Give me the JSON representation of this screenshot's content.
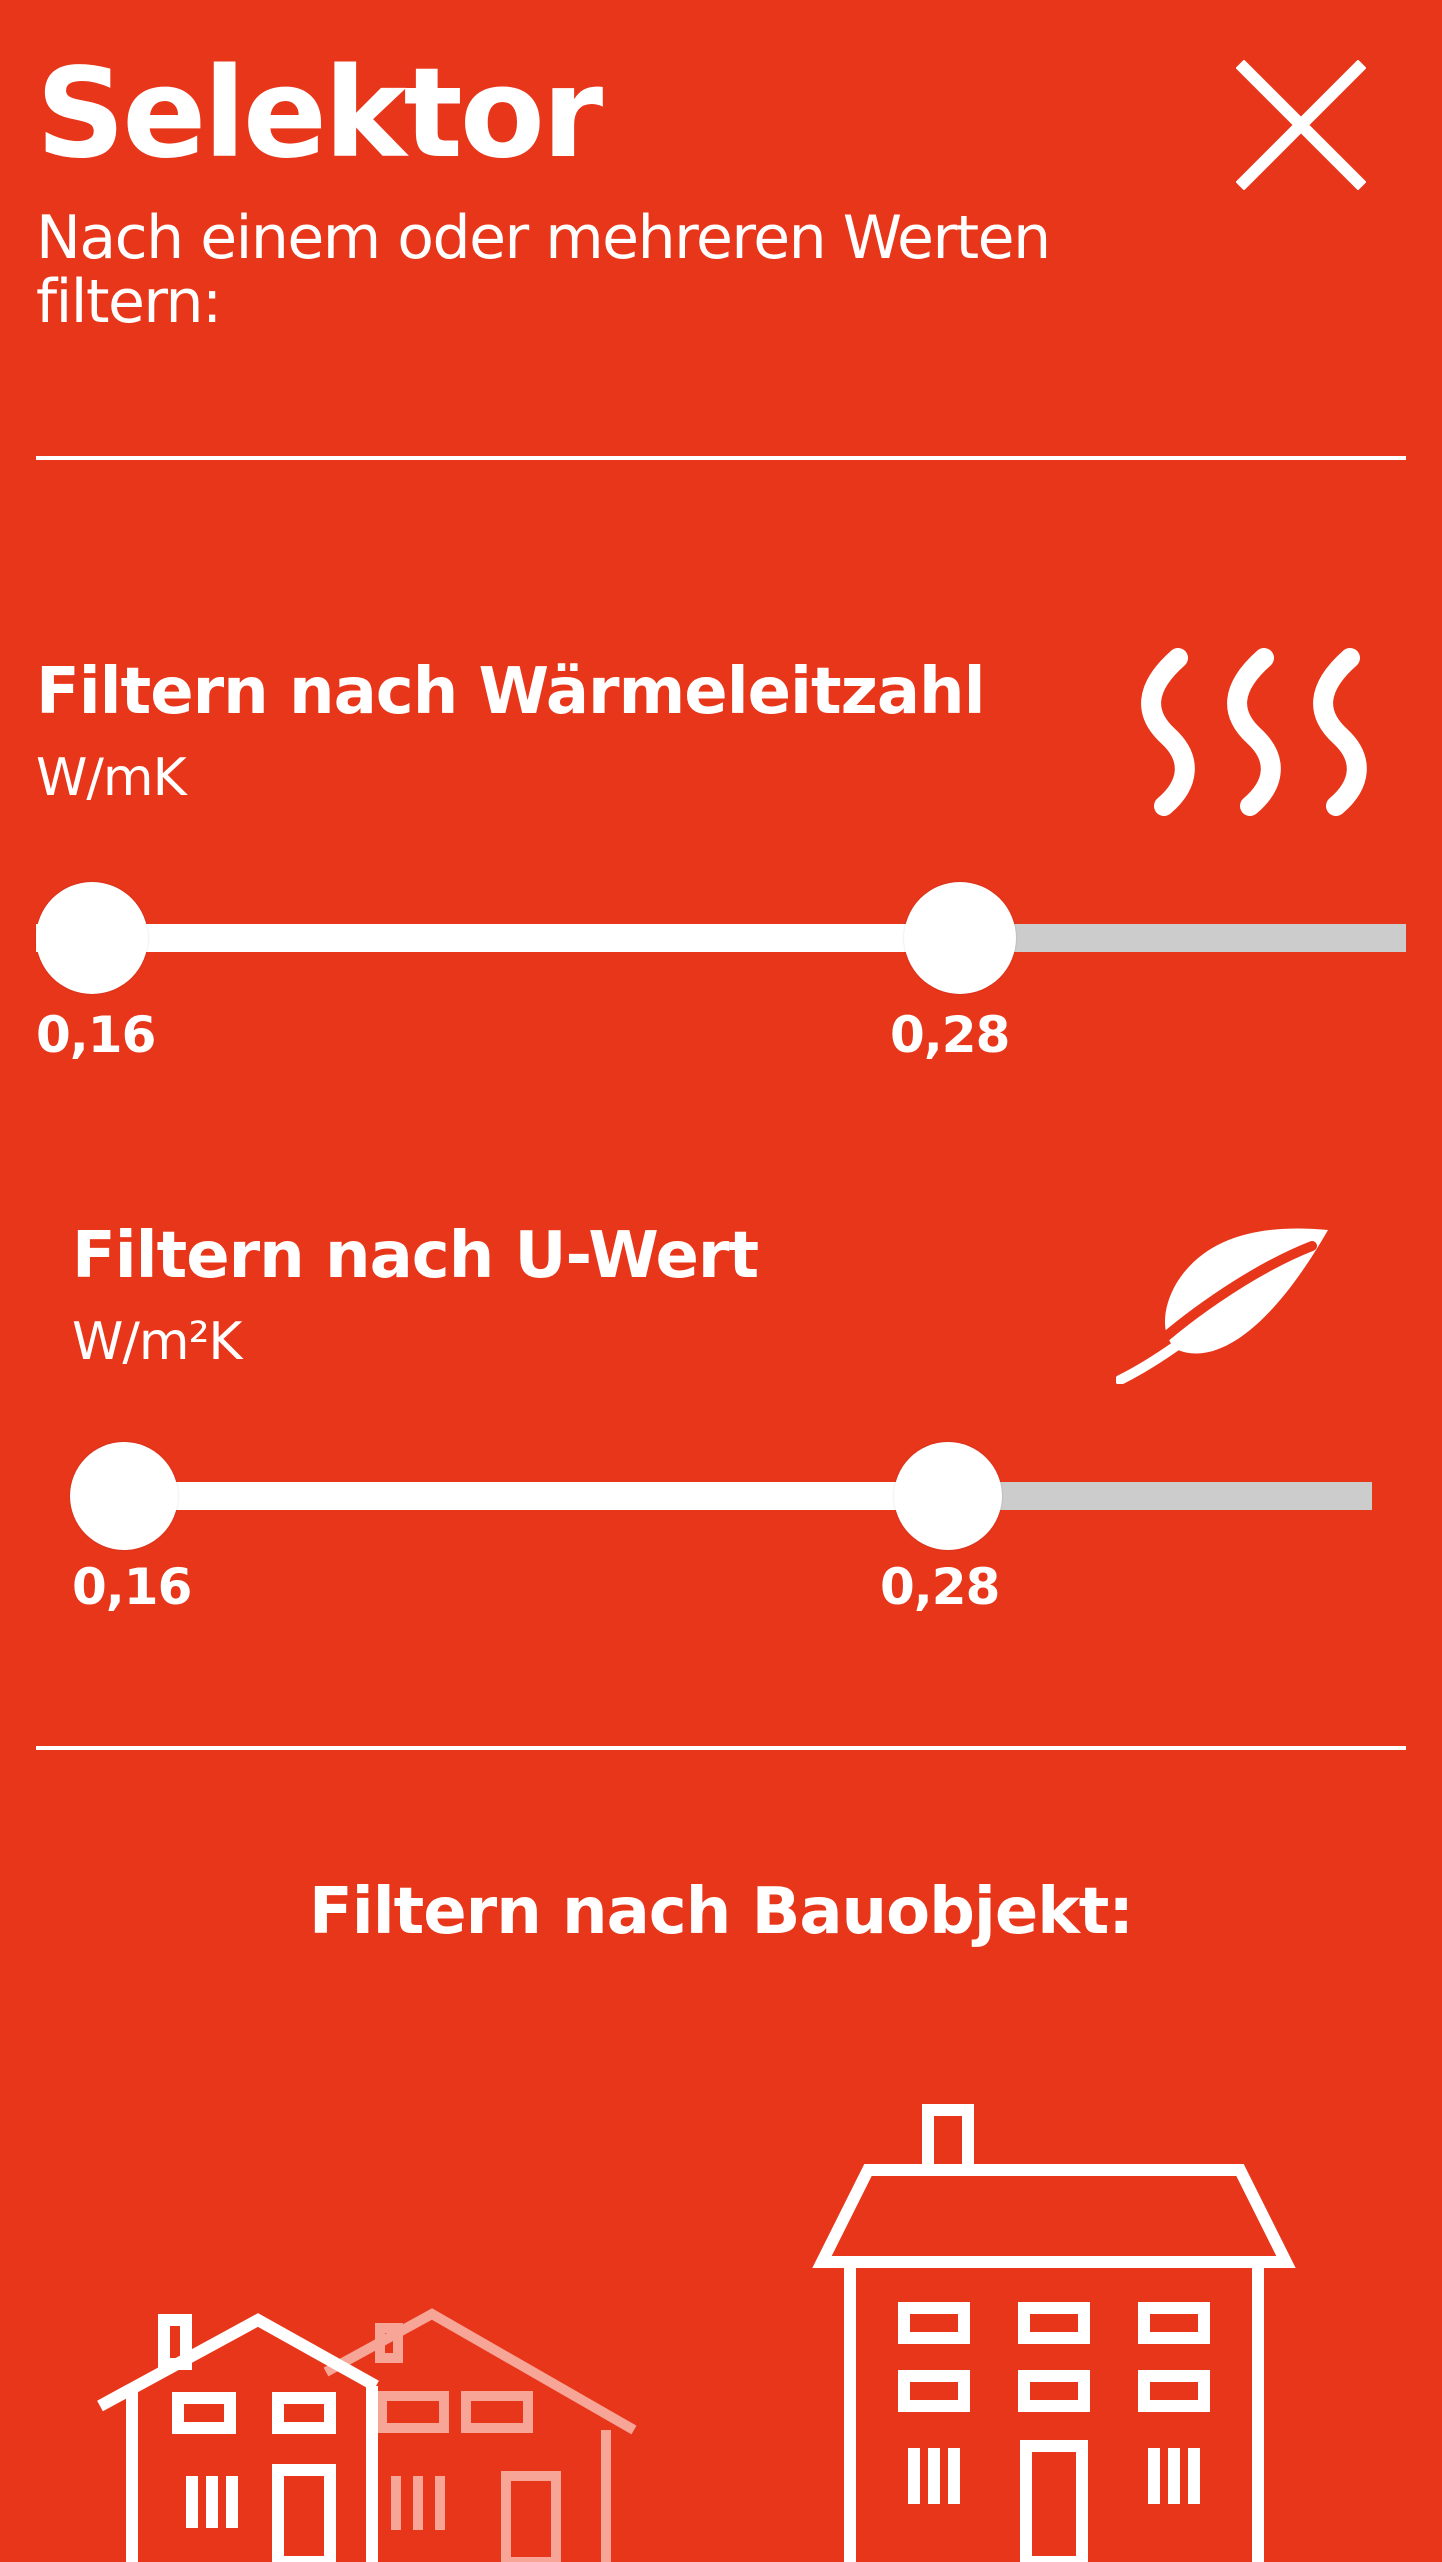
{
  "header": {
    "title": "Selektor",
    "subtitle": "Nach einem oder mehreren Werten filtern:",
    "close_icon": "close-icon"
  },
  "filters": [
    {
      "title": "Filtern nach Wärmeleitzahl",
      "unit": "W/mK",
      "icon": "heat-waves-icon",
      "range": {
        "min_label": "0,16",
        "max_label": "0,28"
      },
      "selected_fraction": 0.7
    },
    {
      "title": "Filtern nach U-Wert",
      "unit": "W/m²K",
      "icon": "leaf-icon",
      "range": {
        "min_label": "0,16",
        "max_label": "0,28"
      },
      "selected_fraction": 0.7
    }
  ],
  "building_filter": {
    "title": "Filtern nach Bauobjekt:",
    "options": [
      {
        "icon": "terraced-houses-icon"
      },
      {
        "icon": "apartment-building-icon"
      }
    ]
  },
  "colors": {
    "background": "#e8361b",
    "foreground": "#ffffff",
    "track_inactive": "#cccccc"
  }
}
